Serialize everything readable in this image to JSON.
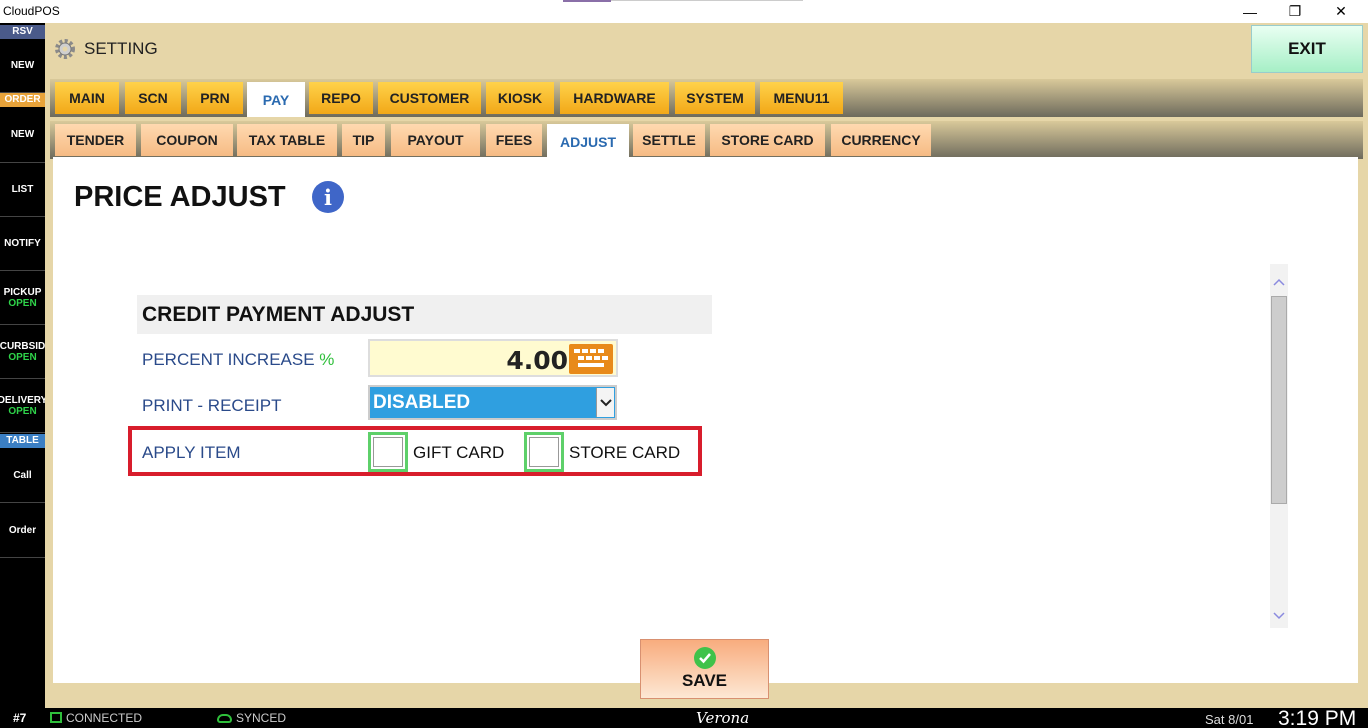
{
  "window": {
    "title": "CloudPOS",
    "minimize": "—",
    "restore": "❐",
    "close": "✕"
  },
  "sidebar": {
    "rsv_label": "RSV",
    "rsv_new": "NEW",
    "order_label": "ORDER",
    "order_new": "NEW",
    "list": "LIST",
    "notify": "NOTIFY",
    "pickup": "PICKUP",
    "pickup_status": "OPEN",
    "curbside": "CURBSID",
    "curbside_status": "OPEN",
    "delivery": "DELIVERY",
    "delivery_status": "OPEN",
    "table_label": "TABLE",
    "call": "Call",
    "order": "Order"
  },
  "header": {
    "title": "SETTING",
    "exit_label": "EXIT"
  },
  "tabs_main": [
    "MAIN",
    "SCN",
    "PRN",
    "PAY",
    "REPO",
    "CUSTOMER",
    "KIOSK",
    "HARDWARE",
    "SYSTEM",
    "MENU11"
  ],
  "tabs_main_active": "PAY",
  "tabs_sub": [
    "TENDER",
    "COUPON",
    "TAX TABLE",
    "TIP",
    "PAYOUT",
    "FEES",
    "ADJUST",
    "SETTLE",
    "STORE CARD",
    "CURRENCY"
  ],
  "tabs_sub_active": "ADJUST",
  "page": {
    "title": "PRICE ADJUST",
    "info_icon": "i",
    "section_title": "CREDIT PAYMENT ADJUST",
    "percent_label": "PERCENT INCREASE",
    "percent_symbol": "%",
    "percent_value": "4.00",
    "print_label": "PRINT - RECEIPT",
    "print_value": "DISABLED",
    "apply_label": "APPLY ITEM",
    "gift_card_label": "GIFT CARD",
    "gift_card_checked": false,
    "store_card_label": "STORE CARD",
    "store_card_checked": false,
    "save_label": "SAVE"
  },
  "statusbar": {
    "station": "#7",
    "connection": "CONNECTED",
    "sync": "SYNCED",
    "store": "Verona",
    "date": "Sat 8/01",
    "time": "3:19 PM"
  },
  "colors": {
    "accent_highlight": "#d81d2c",
    "select_bg": "#2f9fe0",
    "exit_bg": "#a6efc6",
    "status_green": "#2fbf3b"
  },
  "icons": {
    "gear": "gear-icon",
    "info": "info-icon",
    "keyboard": "keyboard-icon",
    "chevron": "chevron-down-icon",
    "save": "checkmark-icon"
  }
}
